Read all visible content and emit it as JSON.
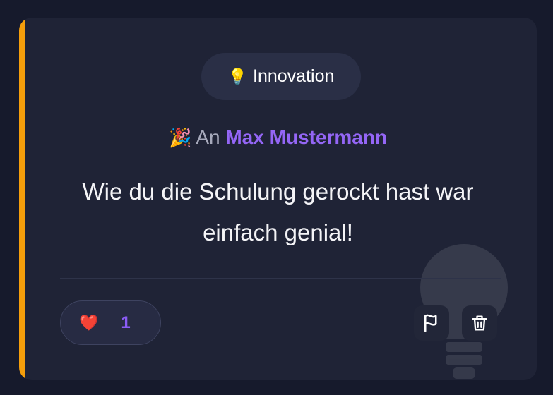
{
  "category": {
    "icon": "lightbulb-icon",
    "emoji": "💡",
    "label": "Innovation"
  },
  "recipient": {
    "icon": "party-popper-icon",
    "emoji": "🎉",
    "prefix": "An",
    "name": "Max Mustermann"
  },
  "message": "Wie du die Schulung gerockt hast war einfach genial!",
  "reactions": {
    "icon": "heart-icon",
    "emoji": "❤️",
    "count": "1"
  },
  "actions": {
    "flag_icon": "flag-icon",
    "delete_icon": "trash-icon"
  },
  "colors": {
    "accent": "#f59e0b",
    "name": "#9466f6",
    "count": "#8b5cf6"
  }
}
